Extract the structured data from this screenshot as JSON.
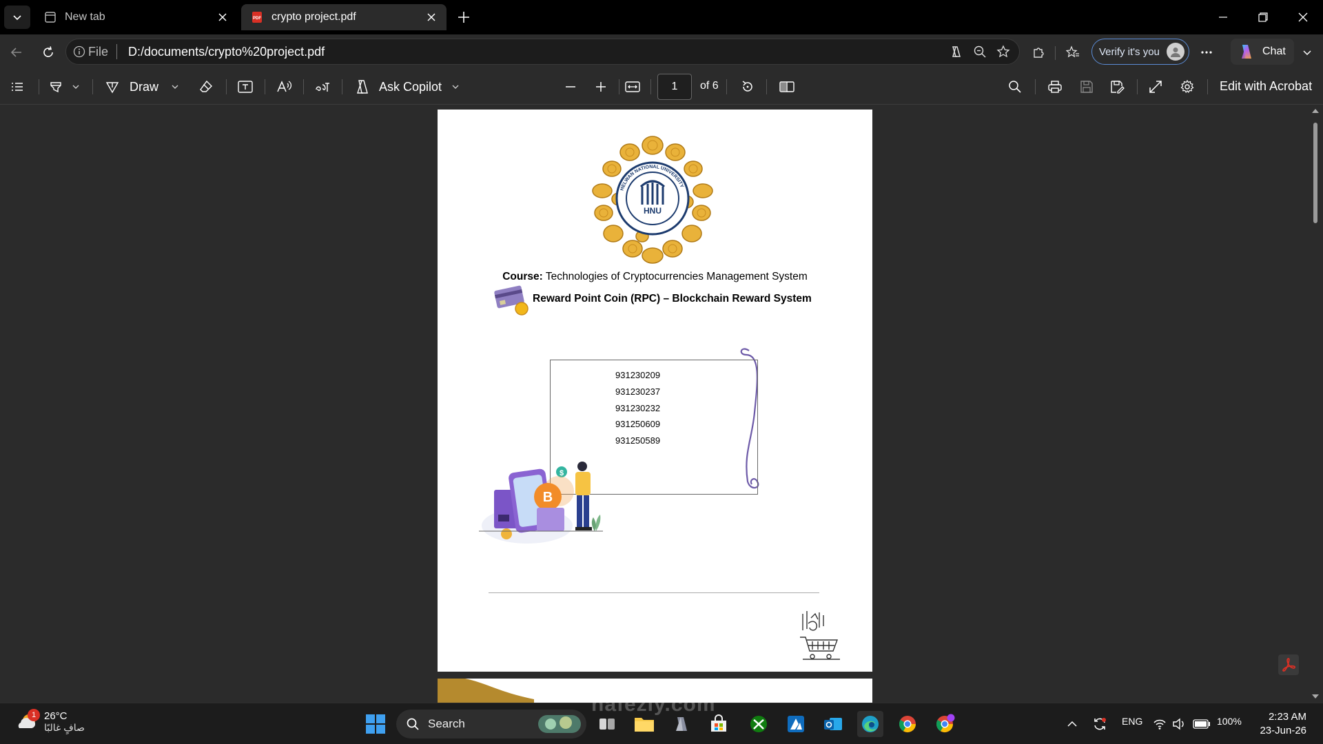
{
  "tabs": [
    {
      "title": "New tab",
      "active": false
    },
    {
      "title": "crypto project.pdf",
      "active": true
    }
  ],
  "address_bar": {
    "site_info": "File",
    "url": "D:/documents/crypto%20project.pdf",
    "verify_label": "Verify it's you",
    "chat_label": "Chat"
  },
  "pdf_toolbar": {
    "draw_label": "Draw",
    "copilot_label": "Ask Copilot",
    "current_page": "1",
    "page_count": "of 6",
    "edit_label": "Edit with Acrobat"
  },
  "document": {
    "course_label": "Course:",
    "course_name": "Technologies of Cryptocurrencies Management System",
    "project_title": "Reward Point Coin (RPC) – Blockchain Reward System",
    "university_short": "HNU",
    "university_ring": "HELWAN NATIONAL UNIVERSITY",
    "student_ids": [
      "931230209",
      "931230237",
      "931230232",
      "931250609",
      "931250589"
    ],
    "bitcoin_symbol": "B",
    "dollar_symbol": "$"
  },
  "taskbar": {
    "weather_temp": "26°C",
    "weather_desc": "صافٍ غالبًا",
    "weather_badge": "1",
    "search_label": "Search",
    "language": "ENG",
    "battery": "100%",
    "time": "2:23 AM",
    "date": "23-Jun-26"
  },
  "watermark": "nafezly.com",
  "colors": {
    "accent_blue": "#5b8cd6",
    "coin_gold": "#e9b23a",
    "seal_navy": "#1c3b6e",
    "acrobat_red": "#d93025"
  }
}
